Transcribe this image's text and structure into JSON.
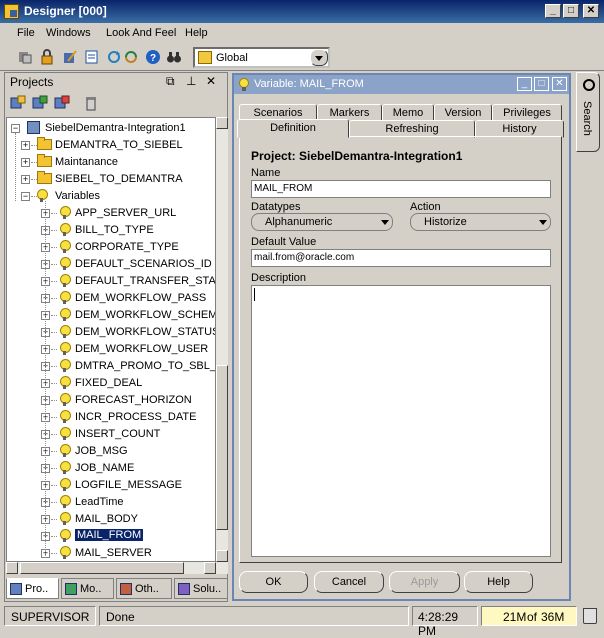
{
  "window": {
    "title": "Designer [000]",
    "icon": "designer-app-icon"
  },
  "menu": [
    {
      "label": "File",
      "u": "F"
    },
    {
      "label": "Windows",
      "u": "W"
    },
    {
      "label": "Look And Feel",
      "u": "L"
    },
    {
      "label": "Help",
      "u": "H"
    }
  ],
  "toolbar": {
    "context": "Global"
  },
  "projects_panel": {
    "title": "Projects",
    "tree": [
      {
        "label": "SiebelDemantra-Integration1",
        "kind": "project",
        "depth": 0,
        "exp": "-"
      },
      {
        "label": "DEMANTRA_TO_SIEBEL",
        "kind": "folder",
        "depth": 1,
        "exp": "+"
      },
      {
        "label": "Maintanance",
        "kind": "folder",
        "depth": 1,
        "exp": "+"
      },
      {
        "label": "SIEBEL_TO_DEMANTRA",
        "kind": "folder",
        "depth": 1,
        "exp": "+"
      },
      {
        "label": "Variables",
        "kind": "varfolder",
        "depth": 1,
        "exp": "-"
      },
      {
        "label": "APP_SERVER_URL",
        "kind": "var",
        "depth": 2,
        "exp": "+"
      },
      {
        "label": "BILL_TO_TYPE",
        "kind": "var",
        "depth": 2,
        "exp": "+"
      },
      {
        "label": "CORPORATE_TYPE",
        "kind": "var",
        "depth": 2,
        "exp": "+"
      },
      {
        "label": "DEFAULT_SCENARIOS_ID",
        "kind": "var",
        "depth": 2,
        "exp": "+"
      },
      {
        "label": "DEFAULT_TRANSFER_STAT",
        "kind": "var",
        "depth": 2,
        "exp": "+"
      },
      {
        "label": "DEM_WORKFLOW_PASS",
        "kind": "var",
        "depth": 2,
        "exp": "+"
      },
      {
        "label": "DEM_WORKFLOW_SCHEMA",
        "kind": "var",
        "depth": 2,
        "exp": "+"
      },
      {
        "label": "DEM_WORKFLOW_STATUS",
        "kind": "var",
        "depth": 2,
        "exp": "+"
      },
      {
        "label": "DEM_WORKFLOW_USER",
        "kind": "var",
        "depth": 2,
        "exp": "+"
      },
      {
        "label": "DMTRA_PROMO_TO_SBL_ST",
        "kind": "var",
        "depth": 2,
        "exp": "+"
      },
      {
        "label": "FIXED_DEAL",
        "kind": "var",
        "depth": 2,
        "exp": "+"
      },
      {
        "label": "FORECAST_HORIZON",
        "kind": "var",
        "depth": 2,
        "exp": "+"
      },
      {
        "label": "INCR_PROCESS_DATE",
        "kind": "var",
        "depth": 2,
        "exp": "+"
      },
      {
        "label": "INSERT_COUNT",
        "kind": "var",
        "depth": 2,
        "exp": "+"
      },
      {
        "label": "JOB_MSG",
        "kind": "var",
        "depth": 2,
        "exp": "+"
      },
      {
        "label": "JOB_NAME",
        "kind": "var",
        "depth": 2,
        "exp": "+"
      },
      {
        "label": "LOGFILE_MESSAGE",
        "kind": "var",
        "depth": 2,
        "exp": "+"
      },
      {
        "label": "LeadTime",
        "kind": "var",
        "depth": 2,
        "exp": "+"
      },
      {
        "label": "MAIL_BODY",
        "kind": "var",
        "depth": 2,
        "exp": "+"
      },
      {
        "label": "MAIL_FROM",
        "kind": "var",
        "depth": 2,
        "exp": "+",
        "selected": true
      },
      {
        "label": "MAIL_SERVER",
        "kind": "var",
        "depth": 2,
        "exp": "+"
      }
    ],
    "bottom_tabs": [
      {
        "label": "Pro..",
        "active": true
      },
      {
        "label": "Mo.."
      },
      {
        "label": "Oth.."
      },
      {
        "label": "Solu.."
      }
    ]
  },
  "variable_window": {
    "title": "Variable: MAIL_FROM",
    "tabs_row1": [
      "Scenarios",
      "Markers",
      "Memo",
      "Version",
      "Privileges"
    ],
    "tabs_row2": [
      "Definition",
      "Refreshing",
      "History"
    ],
    "active_tab": "Definition",
    "project_label": "Project: SiebelDemantra-Integration1",
    "name_label": "Name",
    "name_value": "MAIL_FROM",
    "datatype_label": "Datatypes",
    "datatype_value": "Alphanumeric",
    "action_label": "Action",
    "action_value": "Historize",
    "default_label": "Default Value",
    "default_value": "mail.from@oracle.com",
    "description_label": "Description",
    "description_value": "",
    "buttons": {
      "ok": "OK",
      "cancel": "Cancel",
      "apply": "Apply",
      "help": "Help"
    }
  },
  "search_tab": {
    "label": "Search"
  },
  "status": {
    "user": "SUPERVISOR",
    "message": "Done",
    "time": "4:28:29 PM",
    "memory_used": "21M",
    "memory_of": "of",
    "memory_total": "36M"
  }
}
